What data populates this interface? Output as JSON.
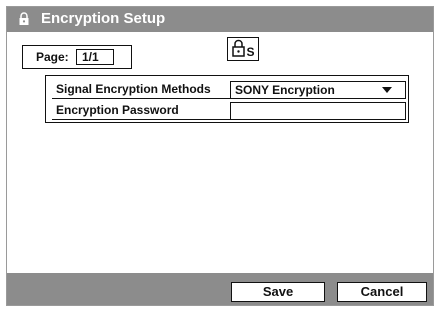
{
  "window": {
    "title": "Encryption Setup",
    "title_icon": "lock-icon"
  },
  "page": {
    "label": "Page:",
    "value": "1/1"
  },
  "header_icon": {
    "name": "lock-s-icon",
    "letter": "S"
  },
  "settings": {
    "rows": [
      {
        "label": "Signal Encryption Methods",
        "value": "SONY Encryption",
        "control": "dropdown"
      },
      {
        "label": "Encryption Password",
        "value": "",
        "control": "text"
      }
    ]
  },
  "buttons": {
    "save": "Save",
    "cancel": "Cancel"
  },
  "colors": {
    "chrome": "#8c8c8c",
    "frame": "#9a9a9a",
    "text": "#111111",
    "background": "#ffffff"
  }
}
